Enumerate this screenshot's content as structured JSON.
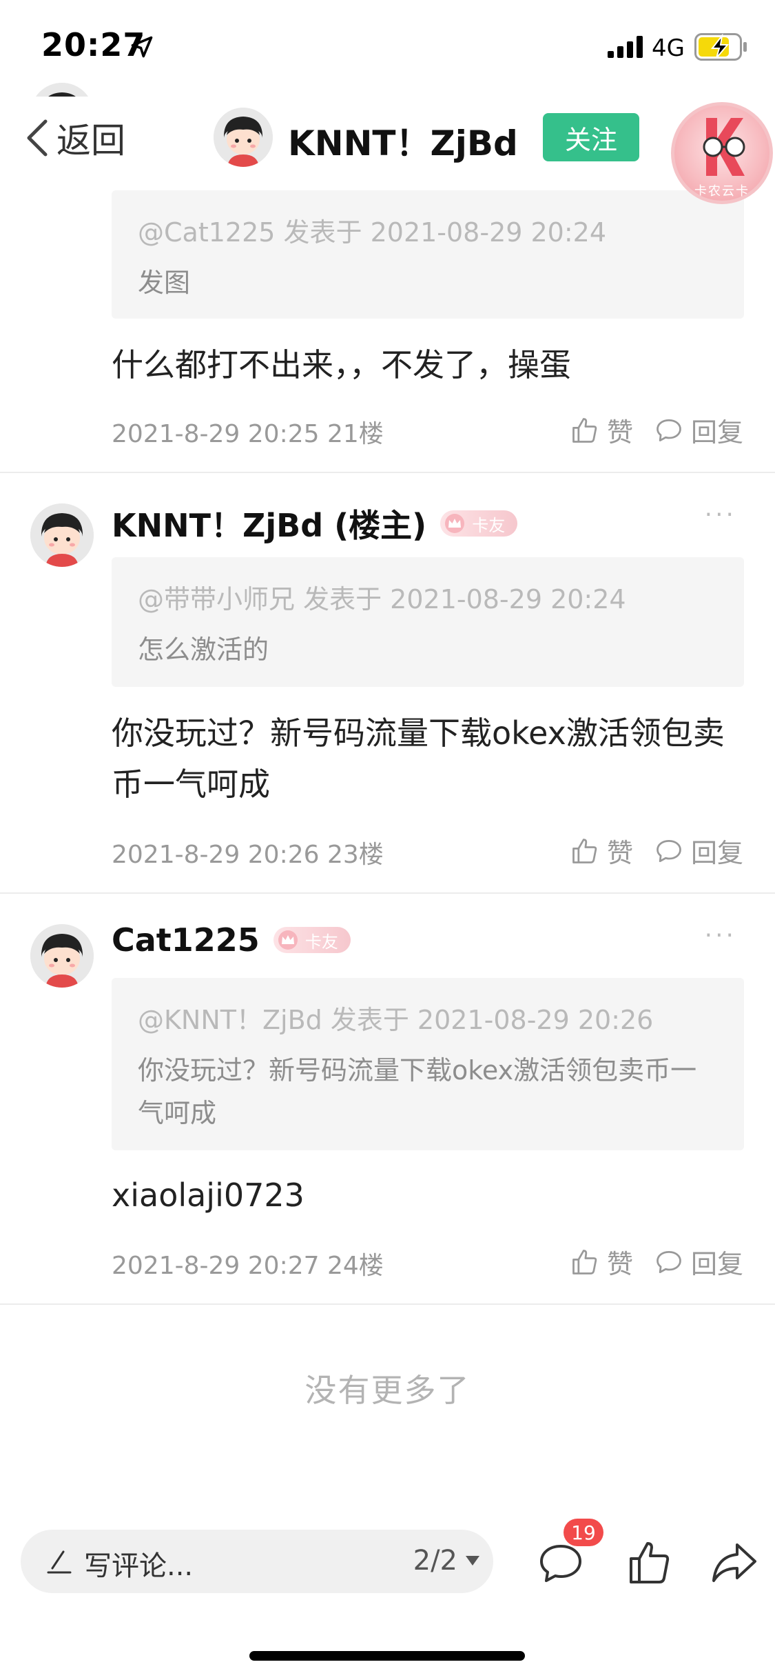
{
  "status_bar": {
    "time": "20:27",
    "network": "4G"
  },
  "nav": {
    "back_label": "返回",
    "title": "KNNT！ZjBd",
    "follow_label": "关注",
    "badge_text": "卡农云卡"
  },
  "posts": [
    {
      "author": "",
      "quote_meta": "@Cat1225 发表于 2021-08-29 20:24",
      "quote_body": "发图",
      "content": "什么都打不出来，，不发了，操蛋",
      "meta": "2021-8-29 20:25  21楼",
      "like_label": "赞",
      "reply_label": "回复"
    },
    {
      "author": "KNNT！ZjBd (楼主)",
      "badge": "卡友",
      "quote_meta": "@带带小师兄 发表于 2021-08-29 20:24",
      "quote_body": "怎么激活的",
      "content": "你没玩过？新号码流量下载okex激活领包卖币一气呵成",
      "meta": "2021-8-29 20:26  23楼",
      "like_label": "赞",
      "reply_label": "回复"
    },
    {
      "author": "Cat1225",
      "badge": "卡友",
      "quote_meta": "@KNNT！ZjBd 发表于 2021-08-29 20:26",
      "quote_body": "你没玩过？新号码流量下载okex激活领包卖币一气呵成",
      "content": "xiaolaji0723",
      "meta": "2021-8-29 20:27  24楼",
      "like_label": "赞",
      "reply_label": "回复"
    }
  ],
  "no_more": "没有更多了",
  "bottom_bar": {
    "comment_placeholder": "写评论...",
    "page_indicator": "2/2",
    "comment_count": "19"
  },
  "colors": {
    "accent": "#35c08b",
    "count_badge": "#f24b4b",
    "quote_bg": "#f5f5f5"
  }
}
